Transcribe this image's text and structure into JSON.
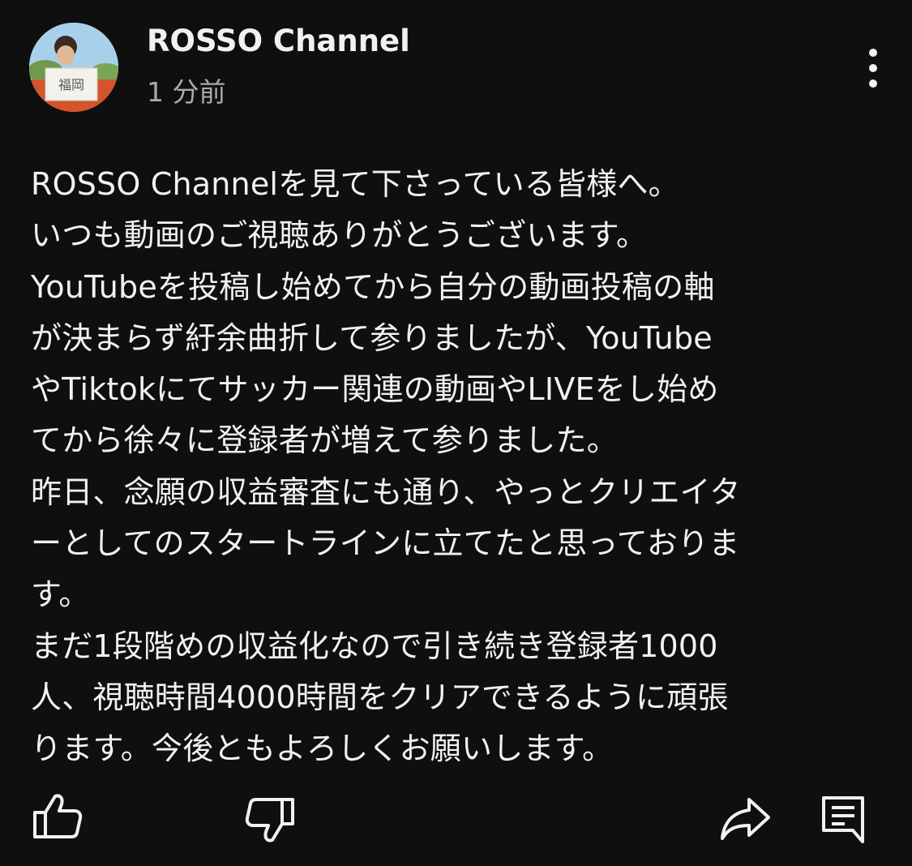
{
  "post": {
    "author": "ROSSO Channel",
    "time": "1 分前",
    "avatar_sign_text": "福岡",
    "body_lines": [
      "ROSSO Channelを見て下さっている皆様へ。",
      "いつも動画のご視聴ありがとうございます。",
      "YouTubeを投稿し始めてから自分の動画投稿の軸",
      "が決まらず紆余曲折して参りましたが、YouTube",
      "やTiktokにてサッカー関連の動画やLIVEをし始め",
      "てから徐々に登録者が増えて参りました。",
      "昨日、念願の収益審査にも通り、やっとクリエイタ",
      "ーとしてのスタートラインに立てたと思っておりま",
      "す。",
      "まだ1段階めの収益化なので引き続き登録者1000",
      "人、視聴時間4000時間をクリアできるように頑張",
      "ります。今後ともよろしくお願いします。"
    ]
  },
  "icons": {
    "more": "more-vert-icon",
    "like": "thumbs-up-icon",
    "dislike": "thumbs-down-icon",
    "share": "share-icon",
    "comment": "comment-icon"
  },
  "colors": {
    "background": "#0f0f0f",
    "text": "#f1f1f1",
    "secondary_text": "#aaaaaa"
  }
}
